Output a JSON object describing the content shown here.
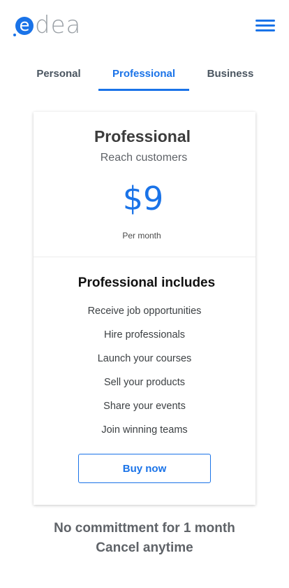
{
  "header": {
    "logo_mark": "e",
    "logo_text": "dea",
    "menu_icon": "hamburger-menu-icon",
    "accent_color": "#1a73e8"
  },
  "tabs": [
    {
      "label": "Personal",
      "active": false
    },
    {
      "label": "Professional",
      "active": true
    },
    {
      "label": "Business",
      "active": false
    }
  ],
  "plan": {
    "name": "Professional",
    "tagline": "Reach customers",
    "price": "$9",
    "period": "Per month",
    "includes_title": "Professional includes",
    "features": [
      "Receive job opportunities",
      "Hire professionals",
      "Launch your courses",
      "Sell your products",
      "Share your events",
      "Join winning teams"
    ],
    "cta_label": "Buy now"
  },
  "note": {
    "line1": "No committment for 1 month",
    "line2": "Cancel anytime"
  }
}
